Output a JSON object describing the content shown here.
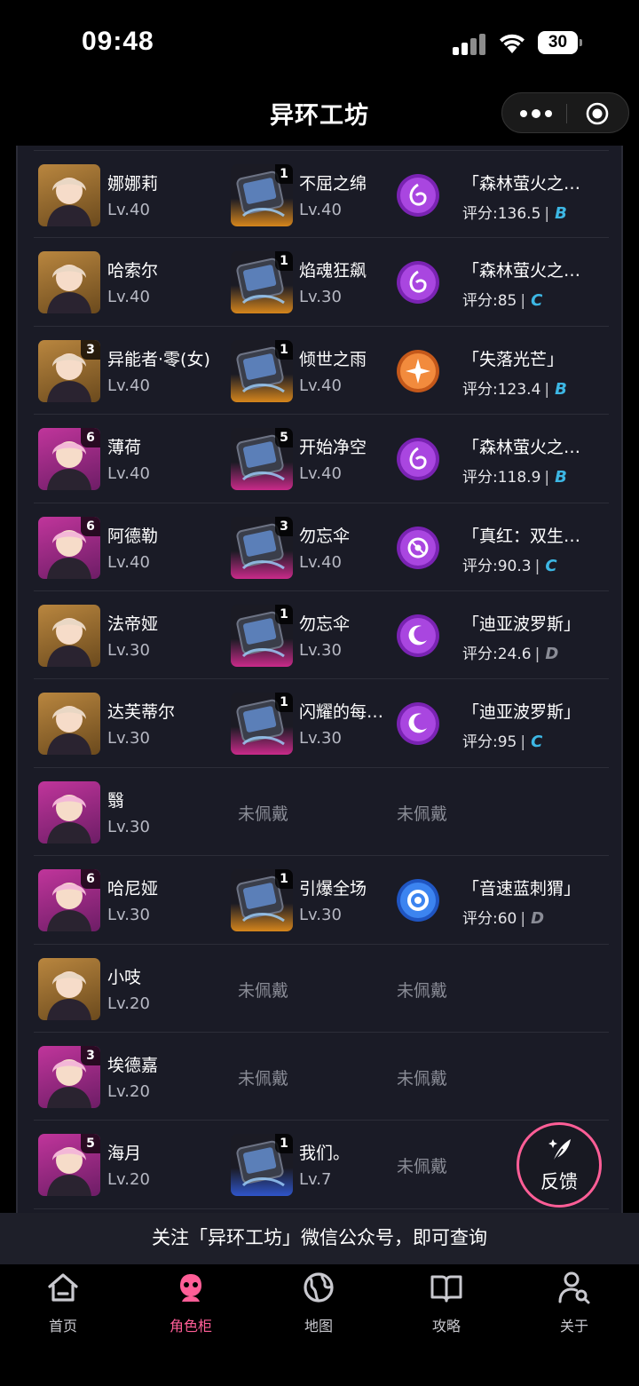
{
  "status": {
    "time": "09:48",
    "battery": "30"
  },
  "nav": {
    "title": "异环工坊"
  },
  "rows": [
    {
      "avatar_style": "gold",
      "rank": "",
      "name": "娜娜莉",
      "level": "Lv.40",
      "weapon": {
        "equipped": true,
        "style": "orange",
        "rank": "1",
        "name": "不屈之绵",
        "level": "Lv.40"
      },
      "equip": {
        "equipped": true,
        "emblem": "purple-wave",
        "name": "「森林萤火之…",
        "score": "评分:136.5",
        "grade": "B",
        "grade_color": "#3db7e4"
      }
    },
    {
      "avatar_style": "gold",
      "rank": "",
      "name": "哈索尔",
      "level": "Lv.40",
      "weapon": {
        "equipped": true,
        "style": "orange",
        "rank": "1",
        "name": "焰魂狂飙",
        "level": "Lv.30"
      },
      "equip": {
        "equipped": true,
        "emblem": "purple-wave",
        "name": "「森林萤火之…",
        "score": "评分:85",
        "grade": "C",
        "grade_color": "#3db7e4"
      }
    },
    {
      "avatar_style": "gold",
      "rank": "3",
      "name": "异能者·零(女)",
      "level": "Lv.40",
      "weapon": {
        "equipped": true,
        "style": "orange",
        "rank": "1",
        "name": "倾世之雨",
        "level": "Lv.40"
      },
      "equip": {
        "equipped": true,
        "emblem": "orange-compass",
        "name": "「失落光芒」",
        "score": "评分:123.4",
        "grade": "B",
        "grade_color": "#3db7e4"
      }
    },
    {
      "avatar_style": "purple",
      "rank": "6",
      "name": "薄荷",
      "level": "Lv.40",
      "weapon": {
        "equipped": true,
        "style": "pink",
        "rank": "5",
        "name": "开始净空",
        "level": "Lv.40"
      },
      "equip": {
        "equipped": true,
        "emblem": "purple-wave",
        "name": "「森林萤火之…",
        "score": "评分:118.9",
        "grade": "B",
        "grade_color": "#3db7e4"
      }
    },
    {
      "avatar_style": "purple",
      "rank": "6",
      "name": "阿德勒",
      "level": "Lv.40",
      "weapon": {
        "equipped": true,
        "style": "pink",
        "rank": "3",
        "name": "勿忘伞",
        "level": "Lv.40"
      },
      "equip": {
        "equipped": true,
        "emblem": "purple-target",
        "name": "「真红：双生…",
        "score": "评分:90.3",
        "grade": "C",
        "grade_color": "#3db7e4"
      }
    },
    {
      "avatar_style": "gold",
      "rank": "",
      "name": "法帝娅",
      "level": "Lv.30",
      "weapon": {
        "equipped": true,
        "style": "pink",
        "rank": "1",
        "name": "勿忘伞",
        "level": "Lv.30"
      },
      "equip": {
        "equipped": true,
        "emblem": "purple-moon",
        "name": "「迪亚波罗斯」",
        "score": "评分:24.6",
        "grade": "D",
        "grade_color": "#8a8c96"
      }
    },
    {
      "avatar_style": "gold",
      "rank": "",
      "name": "达芙蒂尔",
      "level": "Lv.30",
      "weapon": {
        "equipped": true,
        "style": "pink",
        "rank": "1",
        "name": "闪耀的每…",
        "level": "Lv.30"
      },
      "equip": {
        "equipped": true,
        "emblem": "purple-moon",
        "name": "「迪亚波罗斯」",
        "score": "评分:95",
        "grade": "C",
        "grade_color": "#3db7e4"
      }
    },
    {
      "avatar_style": "purple",
      "rank": "",
      "name": "翳",
      "level": "Lv.30",
      "weapon": {
        "equipped": false,
        "label": "未佩戴"
      },
      "equip": {
        "equipped": false,
        "label": "未佩戴"
      }
    },
    {
      "avatar_style": "purple",
      "rank": "6",
      "name": "哈尼娅",
      "level": "Lv.30",
      "weapon": {
        "equipped": true,
        "style": "orange",
        "rank": "1",
        "name": "引爆全场",
        "level": "Lv.30"
      },
      "equip": {
        "equipped": true,
        "emblem": "blue-ring",
        "name": "「音速蓝刺猬」",
        "score": "评分:60",
        "grade": "D",
        "grade_color": "#8a8c96"
      }
    },
    {
      "avatar_style": "gold",
      "rank": "",
      "name": "小吱",
      "level": "Lv.20",
      "weapon": {
        "equipped": false,
        "label": "未佩戴"
      },
      "equip": {
        "equipped": false,
        "label": "未佩戴"
      }
    },
    {
      "avatar_style": "purple",
      "rank": "3",
      "name": "埃德嘉",
      "level": "Lv.20",
      "weapon": {
        "equipped": false,
        "label": "未佩戴"
      },
      "equip": {
        "equipped": false,
        "label": "未佩戴"
      }
    },
    {
      "avatar_style": "purple",
      "rank": "5",
      "name": "海月",
      "level": "Lv.20",
      "weapon": {
        "equipped": true,
        "style": "blue",
        "rank": "1",
        "name": "我们。",
        "level": "Lv.7"
      },
      "equip": {
        "equipped": false,
        "label": "未佩戴"
      }
    }
  ],
  "feedback": {
    "label": "反馈"
  },
  "banner": {
    "text": "关注「异环工坊」微信公众号，即可查询"
  },
  "tabs": [
    {
      "label": "首页",
      "icon": "home-icon",
      "active": false
    },
    {
      "label": "角色柜",
      "icon": "character-icon",
      "active": true
    },
    {
      "label": "地图",
      "icon": "globe-icon",
      "active": false
    },
    {
      "label": "攻略",
      "icon": "book-icon",
      "active": false
    },
    {
      "label": "关于",
      "icon": "person-search-icon",
      "active": false
    }
  ],
  "colors": {
    "accent": "#ff5e97",
    "grade_blue": "#3db7e4",
    "grade_gray": "#8a8c96",
    "panel": "#1a1b26"
  }
}
